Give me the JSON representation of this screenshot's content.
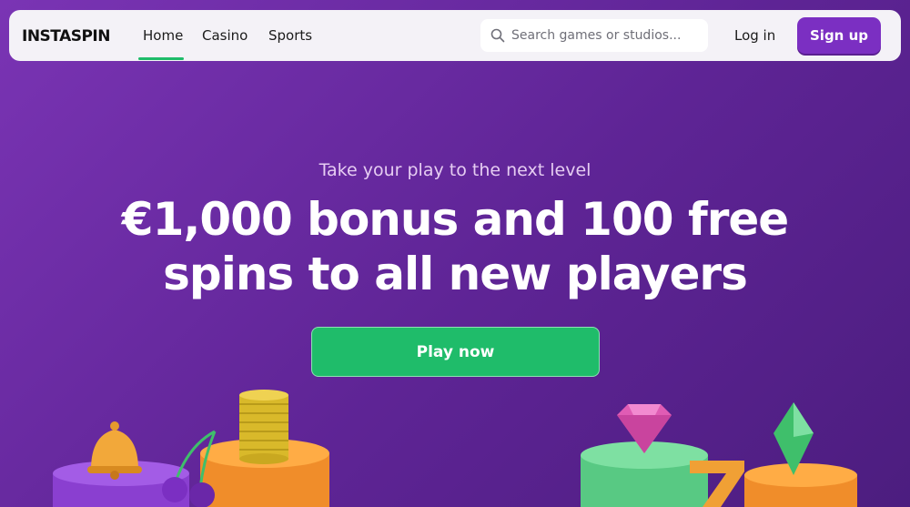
{
  "brand": {
    "logo_text": "INSTASPIN"
  },
  "nav": {
    "tabs": [
      {
        "label": "Home",
        "active": true
      },
      {
        "label": "Casino",
        "active": false
      },
      {
        "label": "Sports",
        "active": false
      }
    ],
    "active_underline_color": "#1fbc6a"
  },
  "search": {
    "placeholder": "Search games or studios...",
    "value": ""
  },
  "auth": {
    "login_label": "Log in",
    "signup_label": "Sign up"
  },
  "hero": {
    "kicker": "Take your play to the next level",
    "title_line_1": "€1,000 bonus and 100 free",
    "title_line_2": "spins to all new players",
    "cta_label": "Play now"
  },
  "colors": {
    "background": "#6a2aa5",
    "signup_button": "#7b2fc2",
    "cta_button": "#1fbc6a"
  },
  "decor_icons": [
    "bell-icon",
    "cherries-icon",
    "coin-stack-icon",
    "pink-diamond-icon",
    "seven-icon",
    "green-gem-icon"
  ]
}
